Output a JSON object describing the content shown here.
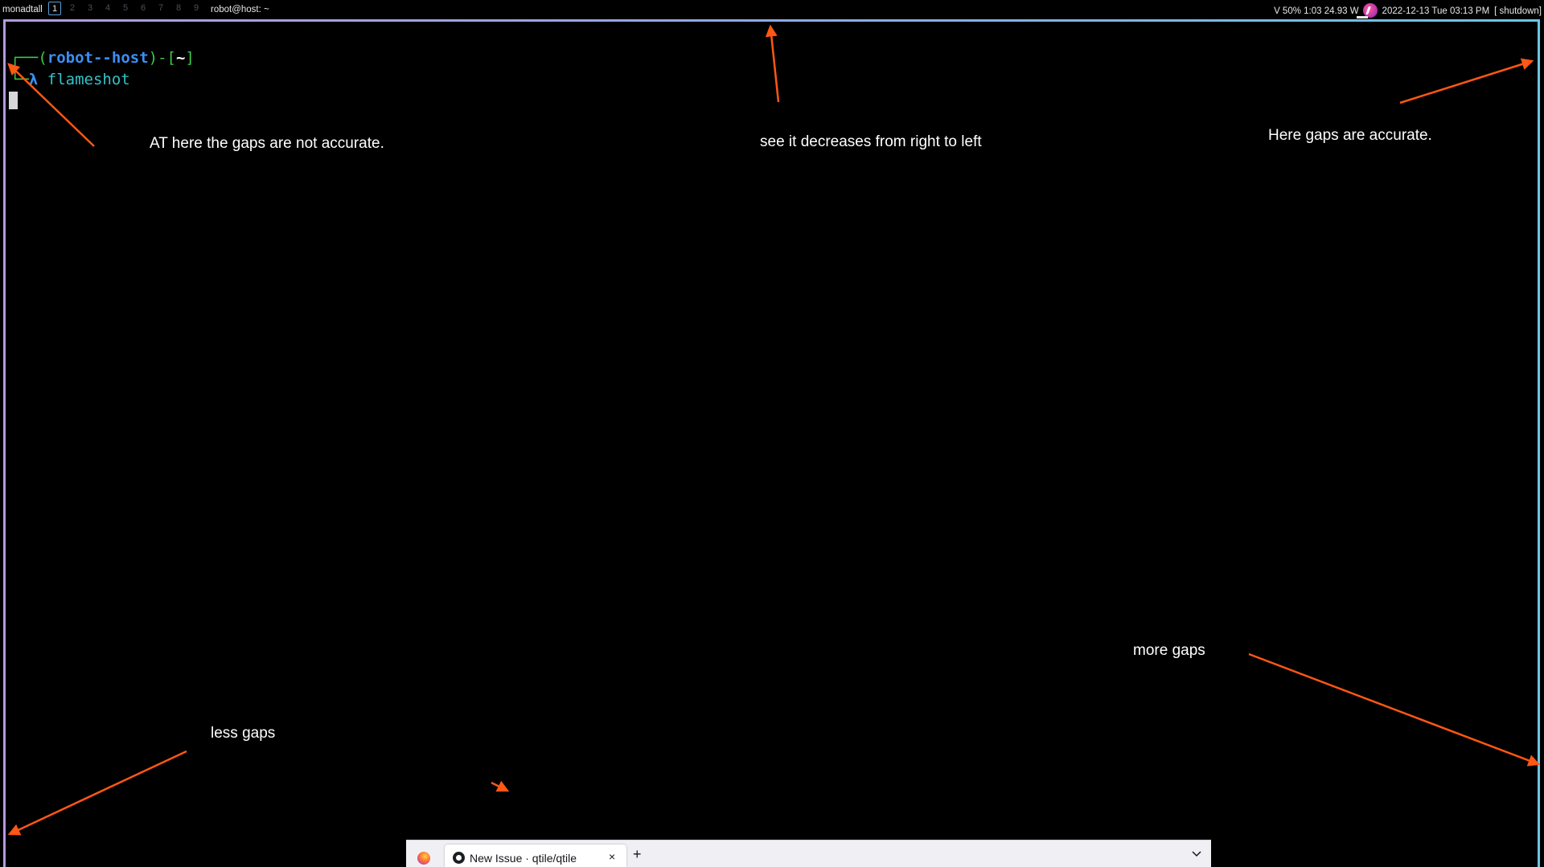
{
  "bar": {
    "layout": "monadtall",
    "groups": [
      "1",
      "2",
      "3",
      "4",
      "5",
      "6",
      "7",
      "8",
      "9"
    ],
    "active_group": "1",
    "window_title": "robot@host: ~",
    "battery": "V 50% 1:03 24.93 W",
    "clock": "2022-12-13 Tue 03:13 PM",
    "shutdown": "[ shutdown]"
  },
  "terminal": {
    "prompt_corner": "┌──",
    "prompt_open": "(",
    "prompt_user": "robot",
    "prompt_sep": "--",
    "prompt_host": "host",
    "prompt_close": ")-[",
    "prompt_dir": "~",
    "prompt_end": "]",
    "cmd_corner": "└─",
    "cmd_symbol": "λ",
    "command": "flameshot"
  },
  "annotations": {
    "top_left": "AT here the gaps are not accurate.",
    "top_center": "see it decreases from right to left",
    "top_right": "Here gaps are accurate.",
    "bottom_right": "more gaps",
    "bottom_left": "less gaps"
  },
  "annotation_color": "#ff5714",
  "border_colors": [
    "#b39ae0",
    "#6cc5e4"
  ],
  "firefox": {
    "tab_title": "New Issue · qtile/qtile",
    "tab_close": "×",
    "new_tab": "+"
  }
}
